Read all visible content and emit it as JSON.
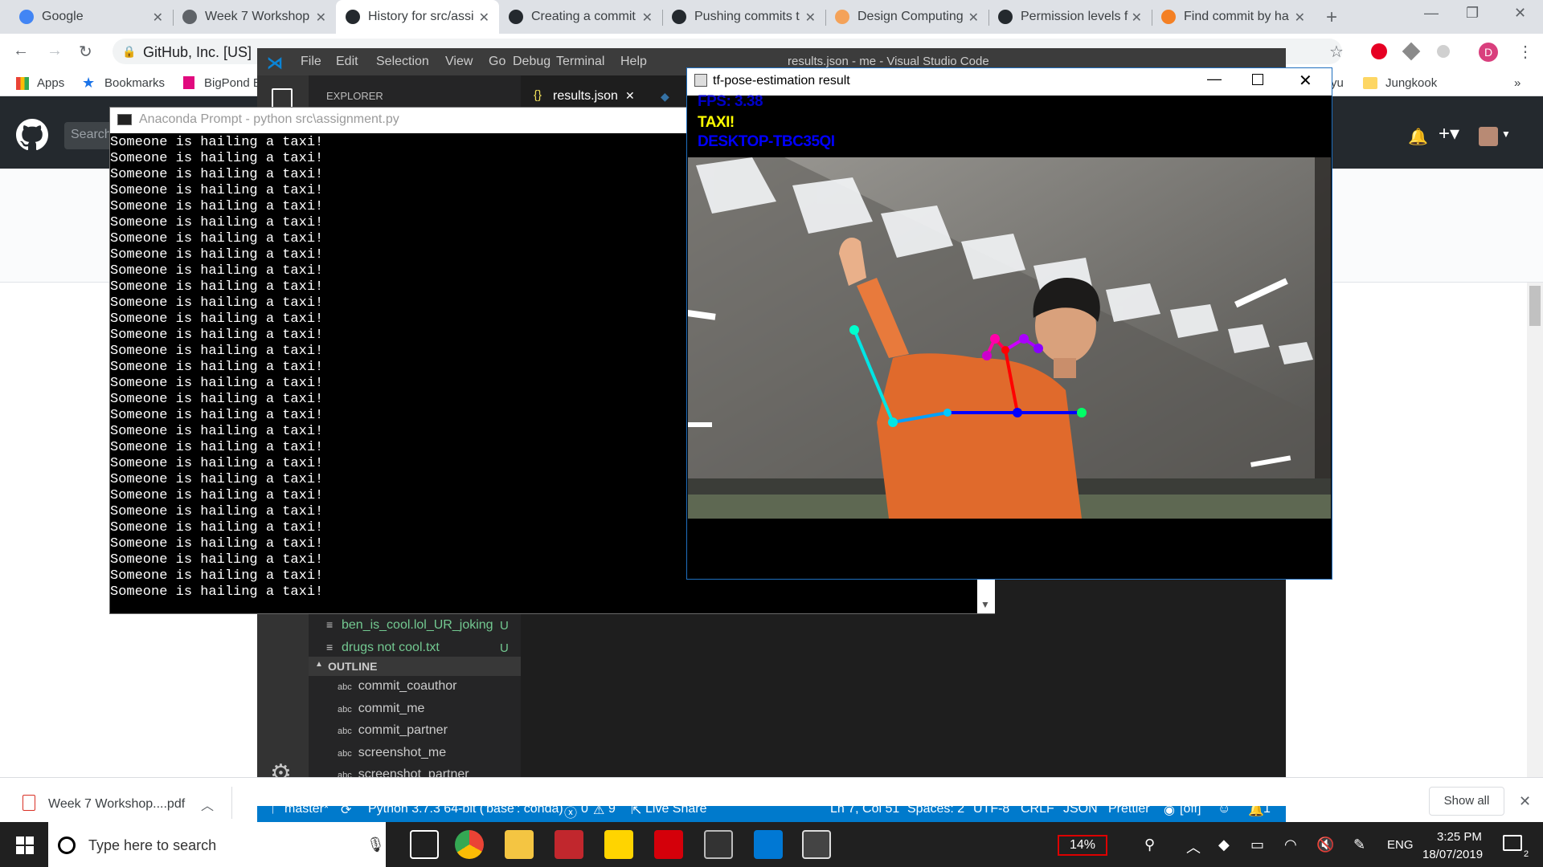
{
  "chrome": {
    "tabs": [
      {
        "label": "Google",
        "color": "#4285f4"
      },
      {
        "label": "Week 7 Workshop",
        "color": "#5f6368"
      },
      {
        "label": "History for src/assi",
        "color": "#24292e"
      },
      {
        "label": "Creating a commit",
        "color": "#24292e"
      },
      {
        "label": "Pushing commits t",
        "color": "#24292e"
      },
      {
        "label": "Design Computing",
        "color": "#f4a259"
      },
      {
        "label": "Permission levels f",
        "color": "#24292e"
      },
      {
        "label": "Find commit by ha",
        "color": "#f48024"
      }
    ],
    "tab_close": "✕",
    "new_tab": "+",
    "omnibox_text": "GitHub, Inc. [US]",
    "avatar_letter": "D",
    "bookmarks": [
      {
        "label": "Apps"
      },
      {
        "label": "Bookmarks"
      },
      {
        "label": "BigPond E"
      },
      {
        "label": "yu"
      },
      {
        "label": "Jungkook"
      }
    ],
    "more": "»"
  },
  "github": {
    "search_placeholder": "Search"
  },
  "vscode": {
    "title": "results.json - me - Visual Studio Code",
    "menu": [
      "File",
      "Edit",
      "Selection",
      "View",
      "Go",
      "Debug",
      "Terminal",
      "Help"
    ],
    "explorer_label": "EXPLORER",
    "active_tab": "results.json",
    "files": [
      {
        "name": "ben_is_cool.lol_UR_joking",
        "status": "U"
      },
      {
        "name": "drugs not cool.txt",
        "status": "U"
      }
    ],
    "outline_label": "OUTLINE",
    "outline_items": [
      "commit_coauthor",
      "commit_me",
      "commit_partner",
      "screenshot_me",
      "screenshot_partner"
    ],
    "status": {
      "branch": "master*",
      "python": "Python 3.7.3 64-bit ('base': conda)",
      "errors": "0",
      "warnings": "9",
      "live_share": "Live Share",
      "position": "Ln 7, Col 51",
      "spaces": "Spaces: 2",
      "encoding": "UTF-8",
      "eol": "CRLF",
      "language": "JSON",
      "formatter": "Prettier",
      "view": "[off]",
      "notifications": "1"
    }
  },
  "anaconda": {
    "title": "Anaconda Prompt - python  src\\assignment.py",
    "line": "Someone is hailing a taxi!",
    "line_count": 29
  },
  "pose_window": {
    "title": "tf-pose-estimation result",
    "fps": "FPS: 3.38",
    "label": "TAXI!",
    "host": "DESKTOP-TBC35QI"
  },
  "downloads": {
    "file": "Week 7 Workshop....pdf",
    "show_all": "Show all"
  },
  "taskbar": {
    "search_placeholder": "Type here to search",
    "battery": "14%",
    "language": "ENG",
    "time": "3:25 PM",
    "date": "18/07/2019",
    "notif_count": "2"
  }
}
